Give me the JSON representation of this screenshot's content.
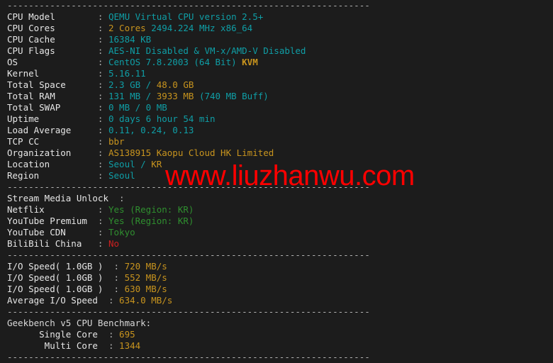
{
  "terminal": {
    "background_color": "#1c1c1c",
    "default_text_color": "#d8d8d8",
    "accent_cyan": "#0f9ea6",
    "accent_gold": "#c8941e",
    "accent_green": "#2f8f2f",
    "accent_red": "#cc2020",
    "watermark": "www.liuzhanwu.com",
    "watermark_color": "#ff0000"
  },
  "separators": {
    "top": "--------------------------------------------------------------------",
    "after_region": "--------------------------------------------------------------------",
    "after_bilibili": "--------------------------------------------------------------------",
    "after_io": "--------------------------------------------------------------------",
    "bottom": "--------------------------------------------------------------------"
  },
  "system_info": {
    "rows": [
      {
        "label": "CPU Model",
        "value_cyan": "QEMU Virtual CPU version 2.5+"
      },
      {
        "label": "CPU Cores",
        "value_gold": "2 Cores",
        "value_cyan": " 2494.224 MHz x86_64"
      },
      {
        "label": "CPU Cache",
        "value_cyan": "16384 KB"
      },
      {
        "label": "CPU Flags",
        "value_cyan": "AES-NI Disabled & VM-x/AMD-V Disabled"
      },
      {
        "label": "OS",
        "value_cyan": "CentOS 7.8.2003 (64 Bit) ",
        "value_gold": "KVM"
      },
      {
        "label": "Kernel",
        "value_cyan": "5.16.11"
      },
      {
        "label": "Total Space",
        "value_cyan": "2.3 GB / ",
        "value_gold": "48.0 GB"
      },
      {
        "label": "Total RAM",
        "value_cyan": "131 MB / ",
        "value_gold": "3933 MB",
        "value_cyan2": " (740 MB Buff)"
      },
      {
        "label": "Total SWAP",
        "value_cyan": "0 MB / 0 MB"
      },
      {
        "label": "Uptime",
        "value_cyan": "0 days 6 hour 54 min"
      },
      {
        "label": "Load Average",
        "value_cyan": "0.11, 0.24, 0.13"
      },
      {
        "label": "TCP CC",
        "value_gold": "bbr"
      },
      {
        "label": "Organization",
        "value_gold": "AS138915 Kaopu Cloud HK Limited"
      },
      {
        "label": "Location",
        "value_cyan": "Seoul / ",
        "value_gold": "KR"
      },
      {
        "label": "Region",
        "value_cyan": "Seoul"
      }
    ]
  },
  "stream_media": {
    "header_label": "Stream Media Unlock",
    "header_value": "",
    "rows": [
      {
        "label": "Netflix",
        "value": "Yes (Region: KR)",
        "state": "green"
      },
      {
        "label": "YouTube Premium",
        "value": "Yes (Region: KR)",
        "state": "green"
      },
      {
        "label": "YouTube CDN",
        "value": "Tokyo",
        "state": "green"
      },
      {
        "label": "BiliBili China",
        "value": "No",
        "state": "red"
      }
    ]
  },
  "io_speed": {
    "rows": [
      {
        "label": "I/O Speed( 1.0GB )",
        "value": "720 MB/s"
      },
      {
        "label": "I/O Speed( 1.0GB )",
        "value": "552 MB/s"
      },
      {
        "label": "I/O Speed( 1.0GB )",
        "value": "630 MB/s"
      },
      {
        "label": "Average I/O Speed",
        "value": "634.0 MB/s"
      }
    ]
  },
  "geekbench": {
    "title": "Geekbench v5 CPU Benchmark:",
    "rows": [
      {
        "label": "Single Core",
        "value": "695"
      },
      {
        "label": "Multi Core",
        "value": "1344"
      }
    ]
  }
}
